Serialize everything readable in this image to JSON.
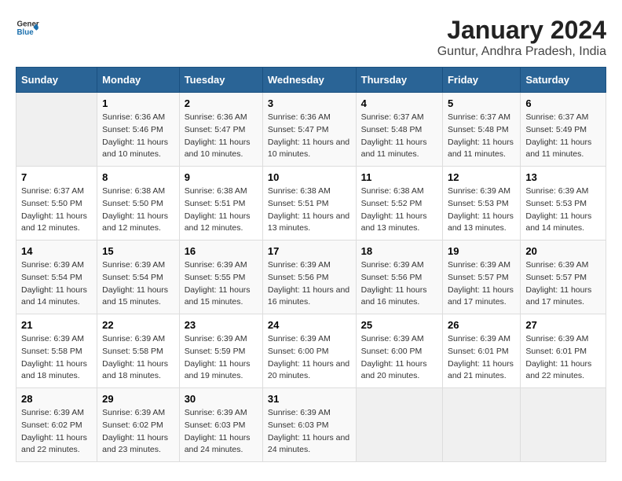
{
  "header": {
    "logo_general": "General",
    "logo_blue": "Blue",
    "title": "January 2024",
    "subtitle": "Guntur, Andhra Pradesh, India"
  },
  "days_of_week": [
    "Sunday",
    "Monday",
    "Tuesday",
    "Wednesday",
    "Thursday",
    "Friday",
    "Saturday"
  ],
  "weeks": [
    [
      {
        "day": "",
        "sunrise": "",
        "sunset": "",
        "daylight": ""
      },
      {
        "day": "1",
        "sunrise": "Sunrise: 6:36 AM",
        "sunset": "Sunset: 5:46 PM",
        "daylight": "Daylight: 11 hours and 10 minutes."
      },
      {
        "day": "2",
        "sunrise": "Sunrise: 6:36 AM",
        "sunset": "Sunset: 5:47 PM",
        "daylight": "Daylight: 11 hours and 10 minutes."
      },
      {
        "day": "3",
        "sunrise": "Sunrise: 6:36 AM",
        "sunset": "Sunset: 5:47 PM",
        "daylight": "Daylight: 11 hours and 10 minutes."
      },
      {
        "day": "4",
        "sunrise": "Sunrise: 6:37 AM",
        "sunset": "Sunset: 5:48 PM",
        "daylight": "Daylight: 11 hours and 11 minutes."
      },
      {
        "day": "5",
        "sunrise": "Sunrise: 6:37 AM",
        "sunset": "Sunset: 5:48 PM",
        "daylight": "Daylight: 11 hours and 11 minutes."
      },
      {
        "day": "6",
        "sunrise": "Sunrise: 6:37 AM",
        "sunset": "Sunset: 5:49 PM",
        "daylight": "Daylight: 11 hours and 11 minutes."
      }
    ],
    [
      {
        "day": "7",
        "sunrise": "Sunrise: 6:37 AM",
        "sunset": "Sunset: 5:50 PM",
        "daylight": "Daylight: 11 hours and 12 minutes."
      },
      {
        "day": "8",
        "sunrise": "Sunrise: 6:38 AM",
        "sunset": "Sunset: 5:50 PM",
        "daylight": "Daylight: 11 hours and 12 minutes."
      },
      {
        "day": "9",
        "sunrise": "Sunrise: 6:38 AM",
        "sunset": "Sunset: 5:51 PM",
        "daylight": "Daylight: 11 hours and 12 minutes."
      },
      {
        "day": "10",
        "sunrise": "Sunrise: 6:38 AM",
        "sunset": "Sunset: 5:51 PM",
        "daylight": "Daylight: 11 hours and 13 minutes."
      },
      {
        "day": "11",
        "sunrise": "Sunrise: 6:38 AM",
        "sunset": "Sunset: 5:52 PM",
        "daylight": "Daylight: 11 hours and 13 minutes."
      },
      {
        "day": "12",
        "sunrise": "Sunrise: 6:39 AM",
        "sunset": "Sunset: 5:53 PM",
        "daylight": "Daylight: 11 hours and 13 minutes."
      },
      {
        "day": "13",
        "sunrise": "Sunrise: 6:39 AM",
        "sunset": "Sunset: 5:53 PM",
        "daylight": "Daylight: 11 hours and 14 minutes."
      }
    ],
    [
      {
        "day": "14",
        "sunrise": "Sunrise: 6:39 AM",
        "sunset": "Sunset: 5:54 PM",
        "daylight": "Daylight: 11 hours and 14 minutes."
      },
      {
        "day": "15",
        "sunrise": "Sunrise: 6:39 AM",
        "sunset": "Sunset: 5:54 PM",
        "daylight": "Daylight: 11 hours and 15 minutes."
      },
      {
        "day": "16",
        "sunrise": "Sunrise: 6:39 AM",
        "sunset": "Sunset: 5:55 PM",
        "daylight": "Daylight: 11 hours and 15 minutes."
      },
      {
        "day": "17",
        "sunrise": "Sunrise: 6:39 AM",
        "sunset": "Sunset: 5:56 PM",
        "daylight": "Daylight: 11 hours and 16 minutes."
      },
      {
        "day": "18",
        "sunrise": "Sunrise: 6:39 AM",
        "sunset": "Sunset: 5:56 PM",
        "daylight": "Daylight: 11 hours and 16 minutes."
      },
      {
        "day": "19",
        "sunrise": "Sunrise: 6:39 AM",
        "sunset": "Sunset: 5:57 PM",
        "daylight": "Daylight: 11 hours and 17 minutes."
      },
      {
        "day": "20",
        "sunrise": "Sunrise: 6:39 AM",
        "sunset": "Sunset: 5:57 PM",
        "daylight": "Daylight: 11 hours and 17 minutes."
      }
    ],
    [
      {
        "day": "21",
        "sunrise": "Sunrise: 6:39 AM",
        "sunset": "Sunset: 5:58 PM",
        "daylight": "Daylight: 11 hours and 18 minutes."
      },
      {
        "day": "22",
        "sunrise": "Sunrise: 6:39 AM",
        "sunset": "Sunset: 5:58 PM",
        "daylight": "Daylight: 11 hours and 18 minutes."
      },
      {
        "day": "23",
        "sunrise": "Sunrise: 6:39 AM",
        "sunset": "Sunset: 5:59 PM",
        "daylight": "Daylight: 11 hours and 19 minutes."
      },
      {
        "day": "24",
        "sunrise": "Sunrise: 6:39 AM",
        "sunset": "Sunset: 6:00 PM",
        "daylight": "Daylight: 11 hours and 20 minutes."
      },
      {
        "day": "25",
        "sunrise": "Sunrise: 6:39 AM",
        "sunset": "Sunset: 6:00 PM",
        "daylight": "Daylight: 11 hours and 20 minutes."
      },
      {
        "day": "26",
        "sunrise": "Sunrise: 6:39 AM",
        "sunset": "Sunset: 6:01 PM",
        "daylight": "Daylight: 11 hours and 21 minutes."
      },
      {
        "day": "27",
        "sunrise": "Sunrise: 6:39 AM",
        "sunset": "Sunset: 6:01 PM",
        "daylight": "Daylight: 11 hours and 22 minutes."
      }
    ],
    [
      {
        "day": "28",
        "sunrise": "Sunrise: 6:39 AM",
        "sunset": "Sunset: 6:02 PM",
        "daylight": "Daylight: 11 hours and 22 minutes."
      },
      {
        "day": "29",
        "sunrise": "Sunrise: 6:39 AM",
        "sunset": "Sunset: 6:02 PM",
        "daylight": "Daylight: 11 hours and 23 minutes."
      },
      {
        "day": "30",
        "sunrise": "Sunrise: 6:39 AM",
        "sunset": "Sunset: 6:03 PM",
        "daylight": "Daylight: 11 hours and 24 minutes."
      },
      {
        "day": "31",
        "sunrise": "Sunrise: 6:39 AM",
        "sunset": "Sunset: 6:03 PM",
        "daylight": "Daylight: 11 hours and 24 minutes."
      },
      {
        "day": "",
        "sunrise": "",
        "sunset": "",
        "daylight": ""
      },
      {
        "day": "",
        "sunrise": "",
        "sunset": "",
        "daylight": ""
      },
      {
        "day": "",
        "sunrise": "",
        "sunset": "",
        "daylight": ""
      }
    ]
  ]
}
